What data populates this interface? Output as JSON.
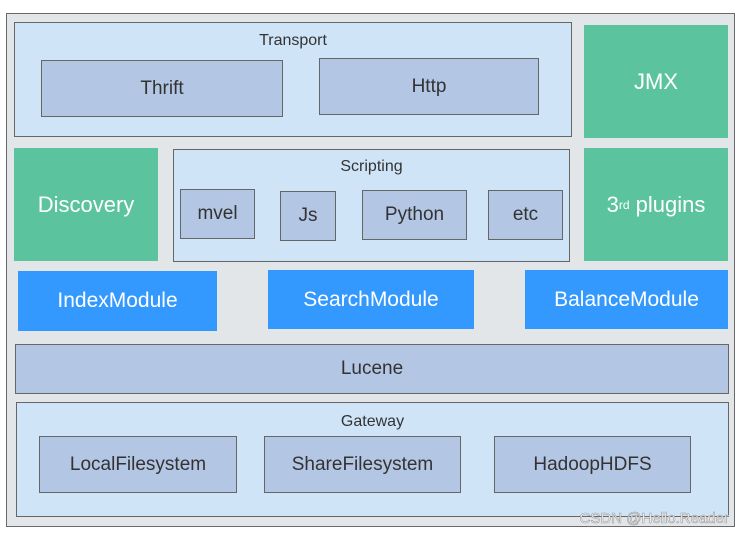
{
  "transport": {
    "title": "Transport",
    "items": [
      "Thrift",
      "Http"
    ]
  },
  "jmx": "JMX",
  "discovery": "Discovery",
  "scripting": {
    "title": "Scripting",
    "items": [
      "mvel",
      "Js",
      "Python",
      "etc"
    ]
  },
  "plugins": {
    "prefix": "3",
    "sup": "rd",
    "suffix": " plugins"
  },
  "modules": [
    "IndexModule",
    "SearchModule",
    "BalanceModule"
  ],
  "lucene": "Lucene",
  "gateway": {
    "title": "Gateway",
    "items": [
      "LocalFilesystem",
      "ShareFilesystem",
      "HadoopHDFS"
    ]
  },
  "watermark": "CSDN @Hello.Reader",
  "colors": {
    "green": "#5bc49f",
    "blue": "#3399ff",
    "light": "#d0e4f8",
    "dark": "#b3c6e4"
  }
}
